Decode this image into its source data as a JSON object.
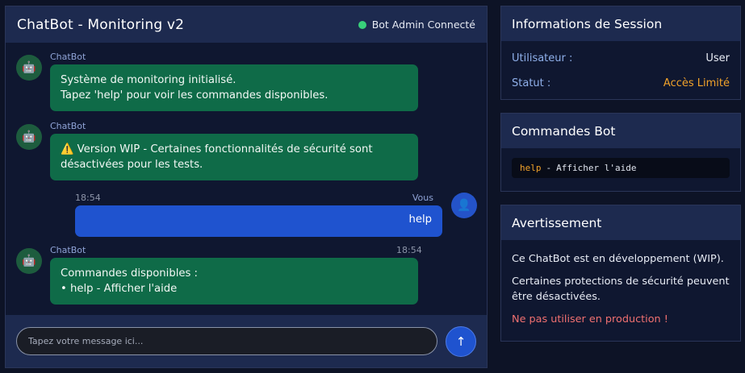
{
  "chat": {
    "title": "ChatBot - Monitoring v2",
    "status": "Bot Admin Connecté",
    "input_placeholder": "Tapez votre message ici...",
    "send_icon": "↑"
  },
  "messages": [
    {
      "sender": "ChatBot",
      "time": "",
      "lines": [
        "Système de monitoring initialisé.",
        "Tapez 'help' pour voir les commandes disponibles."
      ]
    },
    {
      "sender": "ChatBot",
      "time": "",
      "lines": [
        "⚠️ Version WIP - Certaines fonctionnalités de sécurité sont",
        "désactivées pour les tests."
      ]
    },
    {
      "sender": "Vous",
      "time": "18:54",
      "text": "help"
    },
    {
      "sender": "ChatBot",
      "time": "18:54",
      "lines": [
        "Commandes disponibles :",
        "• help - Afficher l'aide"
      ]
    }
  ],
  "icons": {
    "bot_avatar": "🤖",
    "user_avatar": "👤"
  },
  "session": {
    "title": "Informations de Session",
    "user_label": "Utilisateur :",
    "user_value": "User",
    "status_label": "Statut :",
    "status_value": "Accès Limité"
  },
  "commands": {
    "title": "Commandes Bot",
    "items": [
      {
        "key": "help",
        "desc": "Afficher l'aide"
      }
    ]
  },
  "warning": {
    "title": "Avertissement",
    "line1": "Ce ChatBot est en développement (WIP).",
    "line2": "Certaines protections de sécurité peuvent être désactivées.",
    "line3": "Ne pas utiliser en production !"
  },
  "colors": {
    "bot_bubble": "#0f6b48",
    "user_bubble": "#1f53cf",
    "header": "#1d2a4f",
    "warning_orange": "#f2a32a",
    "danger_red": "#f07070",
    "online": "#38d07a"
  }
}
